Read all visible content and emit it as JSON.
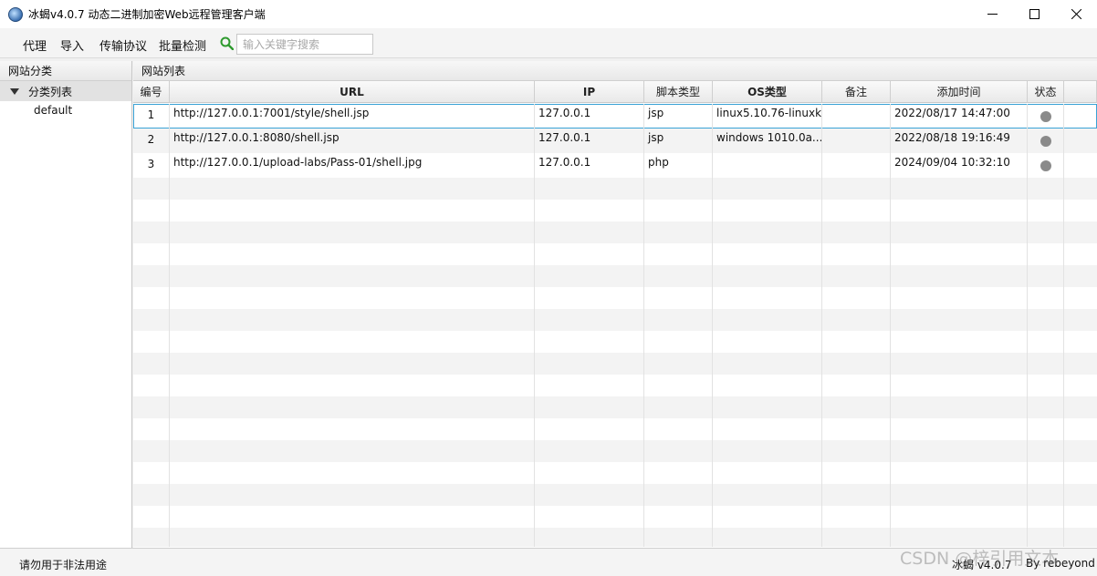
{
  "window": {
    "title": "冰蝎v4.0.7 动态二进制加密Web远程管理客户端"
  },
  "menu": {
    "items": [
      "代理",
      "导入",
      "传输协议",
      "批量检测"
    ],
    "search_placeholder": "输入关键字搜索"
  },
  "left_panel": {
    "header": "网站分类",
    "tree_root": "分类列表",
    "tree_children": [
      "default"
    ]
  },
  "right_panel": {
    "header": "网站列表",
    "columns": [
      "编号",
      "URL",
      "IP",
      "脚本类型",
      "OS类型",
      "备注",
      "添加时间",
      "状态"
    ],
    "rows": [
      {
        "id": "1",
        "url": "http://127.0.0.1:7001/style/shell.jsp",
        "ip": "127.0.0.1",
        "script": "jsp",
        "os": "linux5.10.76-linuxk...",
        "note": "",
        "added": "2022/08/17 14:47:00",
        "status": "unknown"
      },
      {
        "id": "2",
        "url": "http://127.0.0.1:8080/shell.jsp",
        "ip": "127.0.0.1",
        "script": "jsp",
        "os": "windows 1010.0a...",
        "note": "",
        "added": "2022/08/18 19:16:49",
        "status": "unknown"
      },
      {
        "id": "3",
        "url": "http://127.0.0.1/upload-labs/Pass-01/shell.jpg",
        "ip": "127.0.0.1",
        "script": "php",
        "os": "",
        "note": "",
        "added": "2024/09/04 10:32:10",
        "status": "unknown"
      }
    ]
  },
  "statusbar": {
    "warning": "请勿用于非法用途",
    "version": "冰蝎 v4.0.7",
    "author": "By rebeyond"
  },
  "watermark": "CSDN @梓引用文本",
  "colors": {
    "selection_outline": "#39a2d6",
    "status_dot": "#8a8a8a",
    "search_icon": "#2e9a2e"
  }
}
